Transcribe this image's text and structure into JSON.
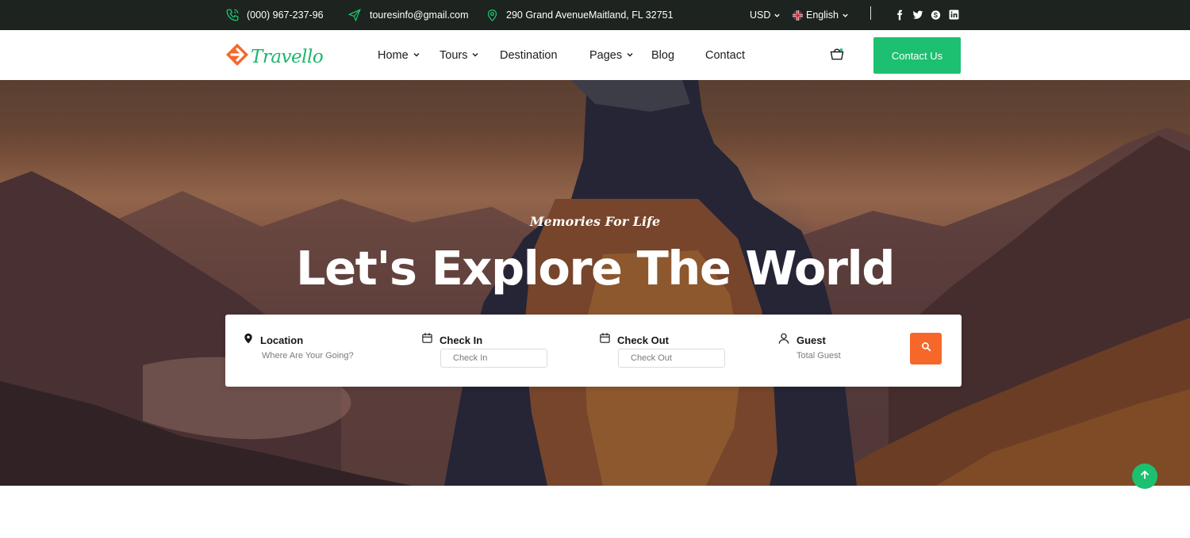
{
  "topbar": {
    "phone": "(000) 967-237-96",
    "email": "touresinfo@gmail.com",
    "address": "290 Grand AvenueMaitland, FL 32751",
    "currency": "USD",
    "language": "English",
    "social_icons": [
      "facebook-icon",
      "twitter-icon",
      "skype-icon",
      "linkedin-icon"
    ]
  },
  "brand": {
    "name": "Travello",
    "accent": "#f7672a",
    "green": "#1cc070"
  },
  "nav": {
    "items": [
      {
        "label": "Home",
        "dropdown": true
      },
      {
        "label": "Tours",
        "dropdown": true
      },
      {
        "label": "Destination",
        "dropdown": false
      },
      {
        "label": "Pages",
        "dropdown": true
      },
      {
        "label": "Blog",
        "dropdown": false
      },
      {
        "label": "Contact",
        "dropdown": false
      }
    ],
    "contact_button": "Contact Us"
  },
  "hero": {
    "tagline": "Memories For Life",
    "headline": "Let's Explore The World"
  },
  "search": {
    "location": {
      "label": "Location",
      "hint": "Where Are Your Going?"
    },
    "check_in": {
      "label": "Check In",
      "placeholder": "Check In"
    },
    "check_out": {
      "label": "Check Out",
      "placeholder": "Check Out"
    },
    "guest": {
      "label": "Guest",
      "hint": "Total Guest"
    }
  }
}
